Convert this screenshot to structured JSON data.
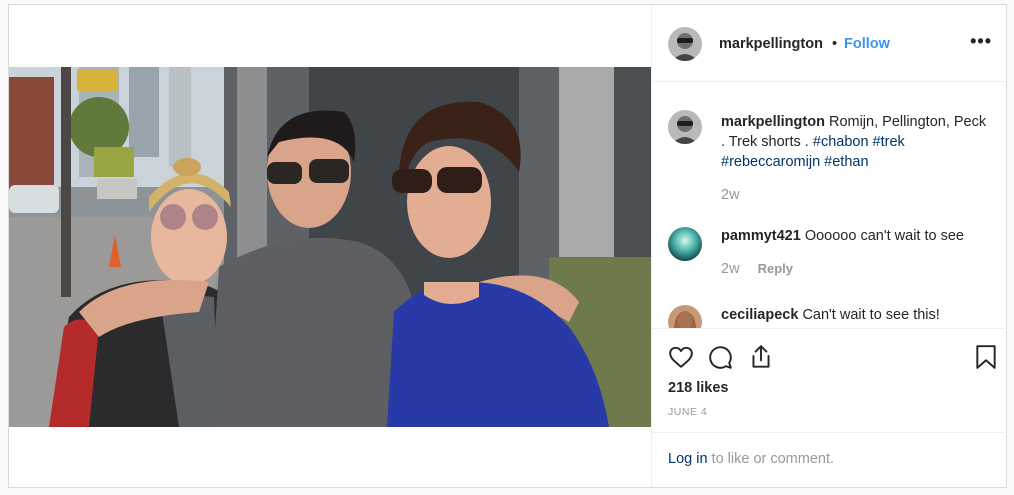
{
  "post": {
    "username": "markpellington",
    "separator": "•",
    "follow_label": "Follow",
    "more_icon": "more-dots-icon",
    "more_label": "•••"
  },
  "comments": [
    {
      "username": "markpellington",
      "text": "Romijn, Pellington, Peck . Trek shorts .",
      "hashtags": [
        "#chabon",
        "#trek",
        "#rebeccaromijn",
        "#ethan"
      ],
      "time": "2w"
    },
    {
      "username": "pammyt421",
      "text": "Oooooo can't wait to see",
      "time": "2w",
      "reply_label": "Reply"
    },
    {
      "username": "ceciliapeck",
      "text": "Can't wait to see this!"
    }
  ],
  "actions": {
    "like_icon": "heart-icon",
    "comment_icon": "comment-icon",
    "share_icon": "share-icon",
    "save_icon": "bookmark-icon"
  },
  "likes": "218 likes",
  "date": "JUNE 4",
  "login": {
    "link": "Log in",
    "rest": " to like or comment."
  },
  "colors": {
    "link_blue": "#3897f0",
    "hashtag": "#003569",
    "muted": "#999999",
    "text": "#262626"
  }
}
